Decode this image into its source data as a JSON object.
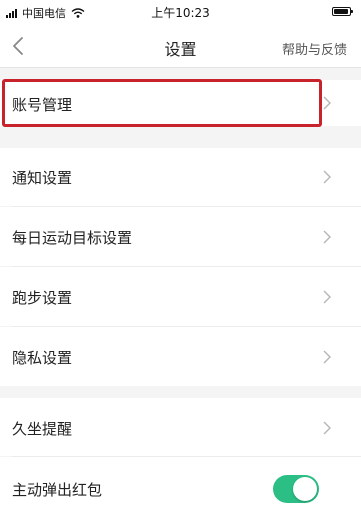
{
  "status_bar": {
    "carrier": "中国电信",
    "time": "上午10:23"
  },
  "nav": {
    "title": "设置",
    "help": "帮助与反馈",
    "back_icon": "chevron-left-icon"
  },
  "settings": {
    "account": {
      "label": "账号管理",
      "icon": "chevron-right-icon",
      "highlighted": true,
      "highlight_color": "#c8222a"
    },
    "notifications": {
      "label": "通知设置",
      "icon": "chevron-right-icon"
    },
    "daily_goal": {
      "label": "每日运动目标设置",
      "icon": "chevron-right-icon"
    },
    "running": {
      "label": "跑步设置",
      "icon": "chevron-right-icon"
    },
    "privacy": {
      "label": "隐私设置",
      "icon": "chevron-right-icon"
    },
    "sedentary_reminder": {
      "label": "久坐提醒",
      "icon": "chevron-right-icon"
    },
    "red_envelope_popup": {
      "label": "主动弹出红包",
      "toggle_on": true,
      "toggle_color": "#2bbf86"
    }
  }
}
